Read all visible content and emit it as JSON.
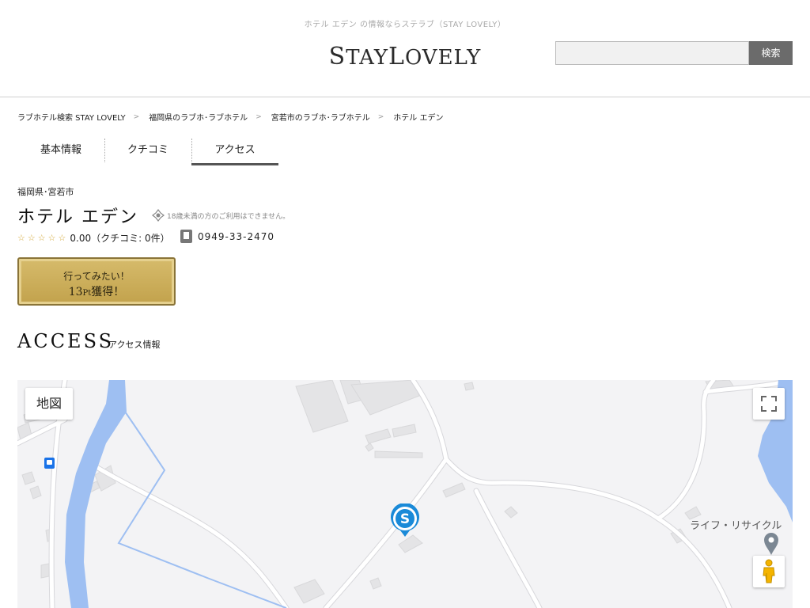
{
  "header": {
    "tagline": "ホテル エデン の情報ならステラブ（STAY LOVELY）",
    "logo_s": "S",
    "logo_tay": "TAY",
    "logo_l": "L",
    "logo_ovely": "OVELY",
    "search_placeholder": "",
    "search_button": "検索"
  },
  "breadcrumb": {
    "items": [
      "ラブホテル検索 STAY LOVELY",
      "福岡県のラブホ･ラブホテル",
      "宮若市のラブホ･ラブホテル",
      "ホテル エデン"
    ],
    "separator": ">"
  },
  "tabs": [
    {
      "label": "基本情報"
    },
    {
      "label": "クチコミ"
    },
    {
      "label": "アクセス"
    }
  ],
  "hotel": {
    "prefecture": "福岡県･宮若市",
    "name": "ホテル エデン",
    "age_notice": "18歳未満の方のご利用はできません。",
    "rating_text": "0.00（クチコミ: 0件）",
    "stars": "☆☆☆☆☆",
    "phone": "0949-33-2470"
  },
  "gold_button": {
    "line1": "行ってみたい！",
    "points": "13",
    "unit": "Pt",
    "suffix": "獲得！"
  },
  "access": {
    "heading": "ACCESS",
    "subheading": "アクセス情報"
  },
  "map": {
    "map_type_label": "地図",
    "poi_label": "ライフ・リサイクル",
    "colors": {
      "river": "#9ebff2",
      "road": "#ffffff",
      "building": "#e4e4e6",
      "marker": "#1a8ad8"
    }
  }
}
